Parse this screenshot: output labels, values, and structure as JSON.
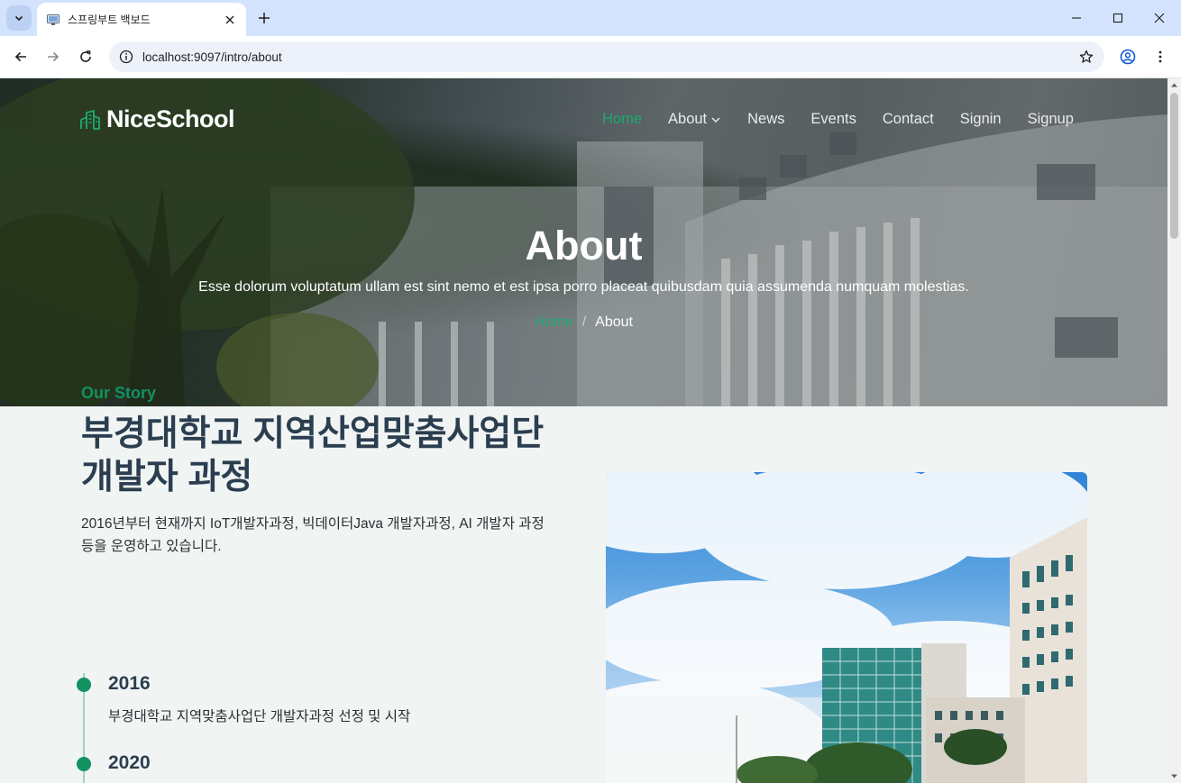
{
  "browser": {
    "tab_title": "스프링부트 백보드",
    "url": "localhost:9097/intro/about"
  },
  "site": {
    "logo": "NiceSchool",
    "nav": [
      {
        "label": "Home",
        "active": true
      },
      {
        "label": "About",
        "active": false,
        "dropdown": true
      },
      {
        "label": "News",
        "active": false
      },
      {
        "label": "Events",
        "active": false
      },
      {
        "label": "Contact",
        "active": false
      },
      {
        "label": "Signin",
        "active": false
      },
      {
        "label": "Signup",
        "active": false
      }
    ],
    "accent_color": "#1dab72"
  },
  "hero": {
    "title": "About",
    "subtitle": "Esse dolorum voluptatum ullam est sint nemo et est ipsa porro placeat quibusdam quia assumenda numquam molestias.",
    "breadcrumb": {
      "home": "Home",
      "sep": "/",
      "current": "About"
    }
  },
  "story": {
    "kicker": "Our Story",
    "headline": "부경대학교 지역산업맞춤사업단 개발자 과정",
    "description": "2016년부터 현재까지 IoT개발자과정, 빅데이터Java 개발자과정, AI 개발자 과정 등을 운영하고 있습니다.",
    "timeline": [
      {
        "year": "2016",
        "text": "부경대학교 지역맞춤사업단 개발자과정 선정 및 시작"
      },
      {
        "year": "2020",
        "text": ""
      }
    ]
  }
}
